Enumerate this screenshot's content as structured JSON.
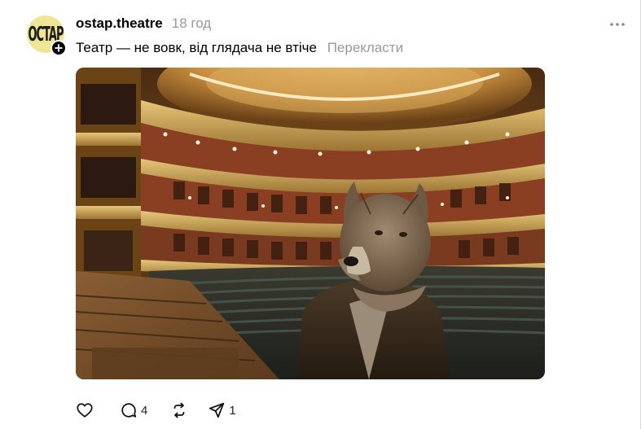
{
  "post": {
    "avatar_text": "OCTAP",
    "username": "ostap.theatre",
    "time": "18 год",
    "text": "Театр — не вовк, від глядача не втіче",
    "translate_label": "Перекласти",
    "image_icon": "theatre-hall-wolf-photo"
  },
  "actions": {
    "like": {
      "icon": "heart-icon",
      "count": ""
    },
    "comment": {
      "icon": "comment-icon",
      "count": "4"
    },
    "repost": {
      "icon": "repost-icon",
      "count": ""
    },
    "share": {
      "icon": "share-icon",
      "count": "1"
    }
  },
  "colors": {
    "avatar_bg": "#efe596",
    "muted_text": "#9a9a9a",
    "theatre_gold": "#c9a24f",
    "seat_green": "#2f3a33"
  }
}
